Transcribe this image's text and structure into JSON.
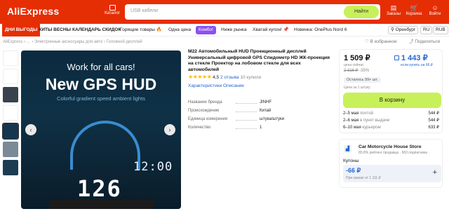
{
  "header": {
    "logo": "AliExpress",
    "catalog_label": "Каталог",
    "search_placeholder": "USB кабели",
    "search_button": "Найти",
    "orders_label": "Заказы",
    "cart_label": "Корзина",
    "login_label": "Войти",
    "brand_color": "#e62e04",
    "accent_color": "#c8f05a"
  },
  "nav": {
    "items": [
      "ДНИ ВЫГОДЫ",
      "ХИТЫ ВЕСНЫ",
      "КАЛЕНДАРЬ СКИДОК",
      "Горящие товары 🔥",
      "Одна цена",
      "Комбо!",
      "Ниже рынка",
      "Хватай купон! 📌",
      "Новинка: OnePlus Nord 6"
    ],
    "location": "Оренбург",
    "lang": "RU",
    "currency": "RUB"
  },
  "breadcrumb": {
    "home": "AliExpress",
    "sep": "›",
    "ellipsis": "…",
    "cat1": "Электронные аксессуары для авто",
    "cat2": "Головной дисплей"
  },
  "actions": {
    "favorites": "В избранное",
    "share": "Поделиться"
  },
  "gallery": {
    "hero_line1": "Work for all cars!",
    "hero_line2": "New GPS HUD",
    "hero_line3": "Colorful gradient speed ambient lights",
    "speed": "126",
    "time": "12:00",
    "prev_icon": "‹",
    "next_icon": "›"
  },
  "product": {
    "title": "M22 Автомобильный HUD Проекционный дисплей Универсальный цифровой GPS Спидометр HD ЖК-проекция на стекле Проектор на лобовом стекле для всех автомобилей",
    "stars": "★★★★★",
    "rating": "4,5",
    "reviews": "2 отзыва",
    "bought": "10 купили",
    "tab_specs": "Характеристики",
    "tab_desc": "Описание",
    "props": [
      {
        "k": "Название бренда",
        "v": "JINHF"
      },
      {
        "k": "Происхождение",
        "v": "Китай"
      },
      {
        "k": "Единица измерения",
        "v": "штука/штуки"
      },
      {
        "k": "Количество",
        "v": "1"
      }
    ]
  },
  "buy": {
    "price": "1 509 ₽",
    "price_note": "цена сейчас",
    "card_price": "1 443 ₽",
    "card_note": "если купить на 66 ₽",
    "old_price": "2 316 ₽",
    "discount": "-35%",
    "stock": "Осталось 99+ шт.",
    "tag": "Цена за 1 штуку",
    "button": "В корзину",
    "delivery": [
      {
        "date": "2–5 мая",
        "method": "почтой",
        "price": "544 ₽"
      },
      {
        "date": "2–6 мая",
        "method": "в пункт выдачи",
        "price": "544 ₽"
      },
      {
        "date": "6–10 мая",
        "method": "курьером",
        "price": "633 ₽"
      }
    ]
  },
  "store": {
    "name": "Car Motorcycle House Store",
    "meta": "85,8% рейтинг продавца · 963 подписчика",
    "coupons_label": "Купоны",
    "coupon_value": "-66 ₽",
    "coupon_note": "При заказе от 1 111 ₽"
  }
}
